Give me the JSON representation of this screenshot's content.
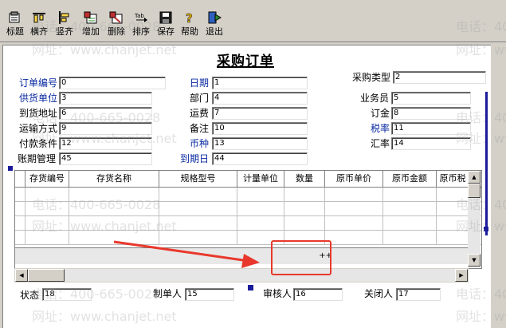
{
  "toolbar": {
    "buttons": [
      {
        "label": "标题",
        "icon": "title-icon"
      },
      {
        "label": "横齐",
        "icon": "align-horizontal-icon"
      },
      {
        "label": "竖齐",
        "icon": "align-vertical-icon"
      },
      {
        "label": "增加",
        "icon": "add-icon"
      },
      {
        "label": "删除",
        "icon": "delete-icon"
      },
      {
        "label": "排序",
        "icon": "sort-icon"
      },
      {
        "label": "保存",
        "icon": "save-icon"
      },
      {
        "label": "帮助",
        "icon": "help-icon"
      },
      {
        "label": "退出",
        "icon": "exit-icon"
      }
    ]
  },
  "form": {
    "title": "采购订单",
    "fields": {
      "order_no": {
        "label": "订单编号",
        "value": "0"
      },
      "date": {
        "label": "日期",
        "value": "1"
      },
      "purchase_type": {
        "label": "采购类型",
        "value": "2"
      },
      "supplier": {
        "label": "供货单位",
        "value": "3"
      },
      "department": {
        "label": "部门",
        "value": "4"
      },
      "salesman": {
        "label": "业务员",
        "value": "5"
      },
      "delivery_address": {
        "label": "到货地址",
        "value": "6"
      },
      "freight": {
        "label": "运费",
        "value": "7"
      },
      "deposit": {
        "label": "订金",
        "value": "8"
      },
      "transport": {
        "label": "运输方式",
        "value": "9"
      },
      "remark": {
        "label": "备注",
        "value": "10"
      },
      "tax_rate": {
        "label": "税率",
        "value": "11"
      },
      "payment_terms": {
        "label": "付款条件",
        "value": "12"
      },
      "currency": {
        "label": "币种",
        "value": "13"
      },
      "exchange_rate": {
        "label": "汇率",
        "value": "14"
      },
      "account_period": {
        "label": "账期管理",
        "value": "45"
      },
      "due_date": {
        "label": "到期日",
        "value": "44"
      }
    }
  },
  "grid": {
    "columns": [
      "存货编号",
      "存货名称",
      "规格型号",
      "计量单位",
      "数量",
      "原币单价",
      "原币金额",
      "原币税"
    ],
    "sum_marker": "++"
  },
  "footer": {
    "status": {
      "label": "状态",
      "value": "18"
    },
    "creator": {
      "label": "制单人",
      "value": "15"
    },
    "reviewer": {
      "label": "审核人",
      "value": "16"
    },
    "closer": {
      "label": "关闭人",
      "value": "17"
    }
  },
  "watermark": {
    "phone": "电话：400-665-0028",
    "site": "网址：www.chanjet.net"
  },
  "colors": {
    "blue_label": "#0a2aa0",
    "highlight": "#e8382c",
    "arrow": "#e8382c"
  }
}
